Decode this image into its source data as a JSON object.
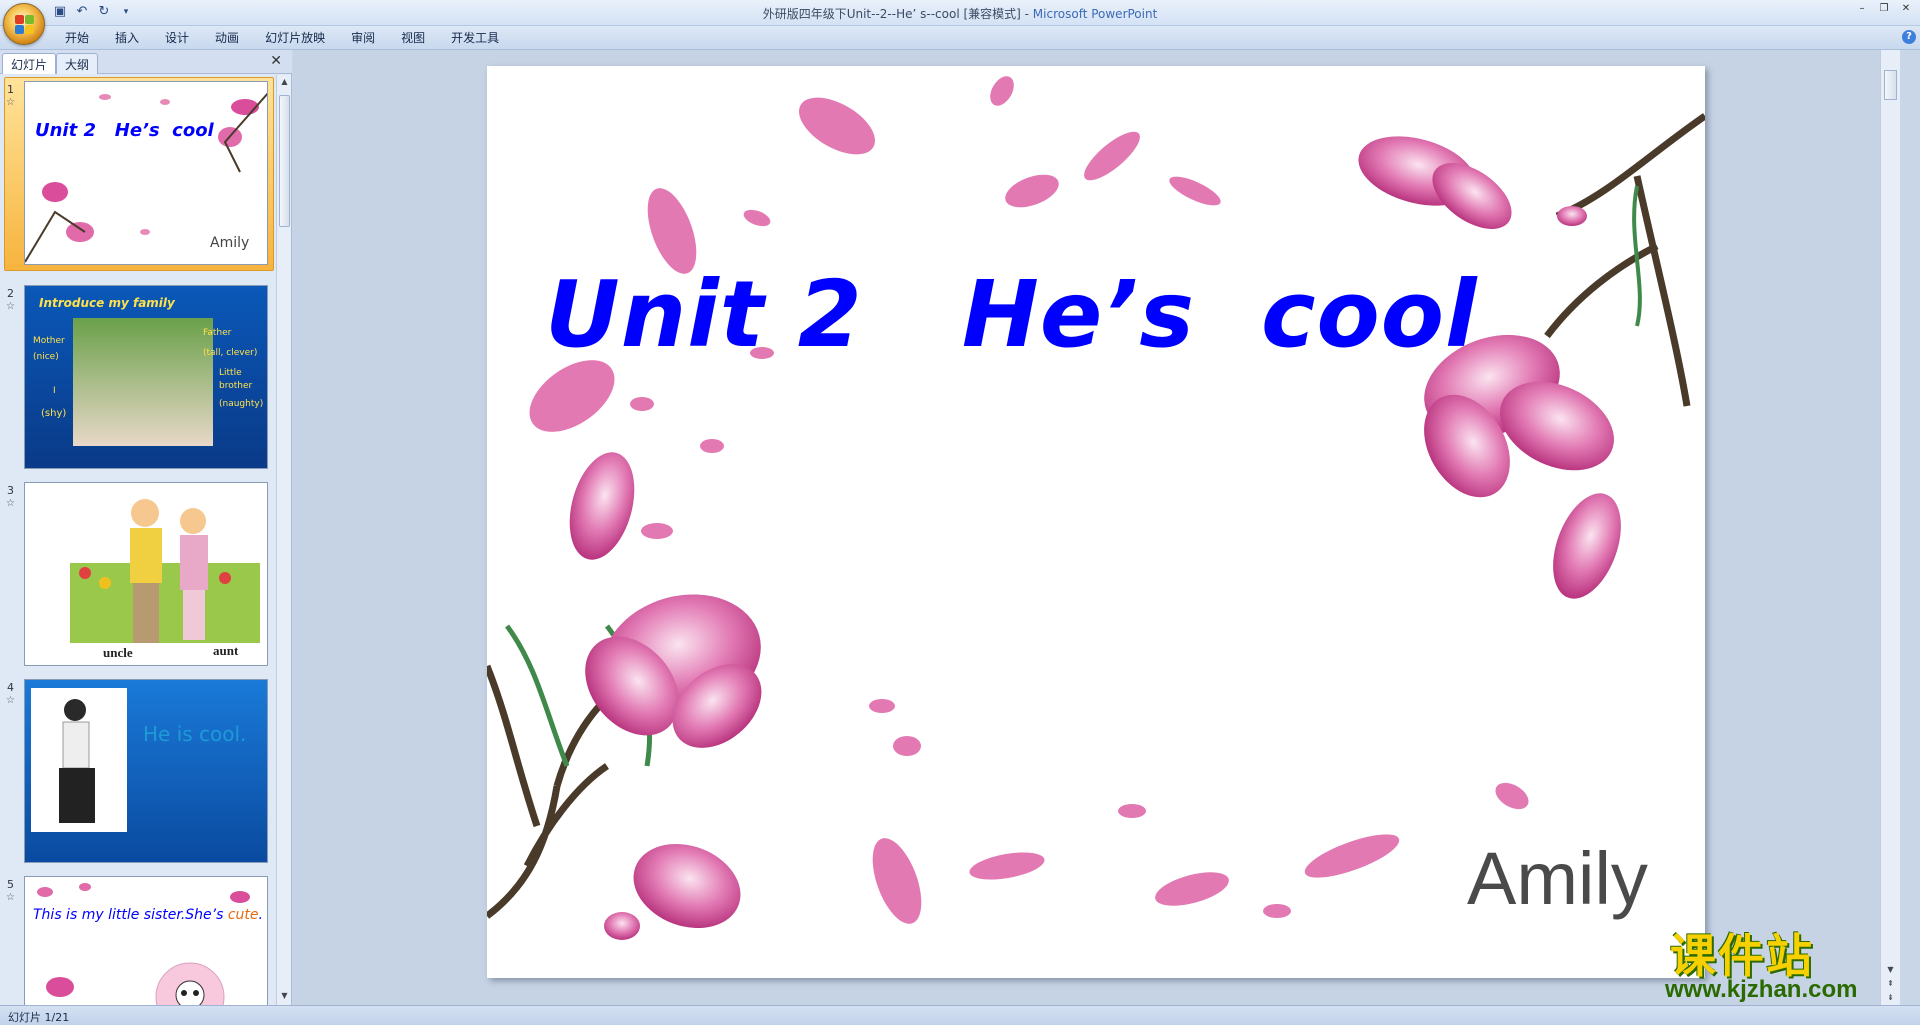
{
  "window": {
    "title": "外研版四年级下Unit--2--He’ s--cool [兼容模式]",
    "app_name": "Microsoft PowerPoint",
    "separator": " - "
  },
  "ribbon": {
    "tabs": [
      "开始",
      "插入",
      "设计",
      "动画",
      "幻灯片放映",
      "审阅",
      "视图",
      "开发工具"
    ]
  },
  "left_pane": {
    "tabs": [
      "幻灯片",
      "大纲"
    ],
    "slides": [
      {
        "number": "1",
        "title": "Unit 2   He’s  cool",
        "author": "Amily"
      },
      {
        "number": "2",
        "heading": "Introduce my family",
        "labels": [
          "Mother",
          "(nice)",
          "I",
          "(shy)",
          "Father",
          "(tall, clever)",
          "Little",
          "brother",
          "(naughty)"
        ]
      },
      {
        "number": "3",
        "labels": [
          "uncle",
          "aunt"
        ]
      },
      {
        "number": "4",
        "text": "He is cool."
      },
      {
        "number": "5",
        "text_main": "This is my little sister.She’s",
        "text_highlight": "cute",
        "text_end": "."
      }
    ]
  },
  "slide": {
    "title": "Unit 2   He’s  cool",
    "author": "Amily",
    "title_color": "#0000ff"
  },
  "status_bar": {
    "text": "幻灯片 1/21"
  },
  "watermark": {
    "cn": "课件站",
    "url": "www.kjzhan.com"
  },
  "colors": {
    "accent_blue": "#0000ff",
    "flower_pink": "#d94d9a",
    "ribbon_bg": "#dde8f6"
  }
}
